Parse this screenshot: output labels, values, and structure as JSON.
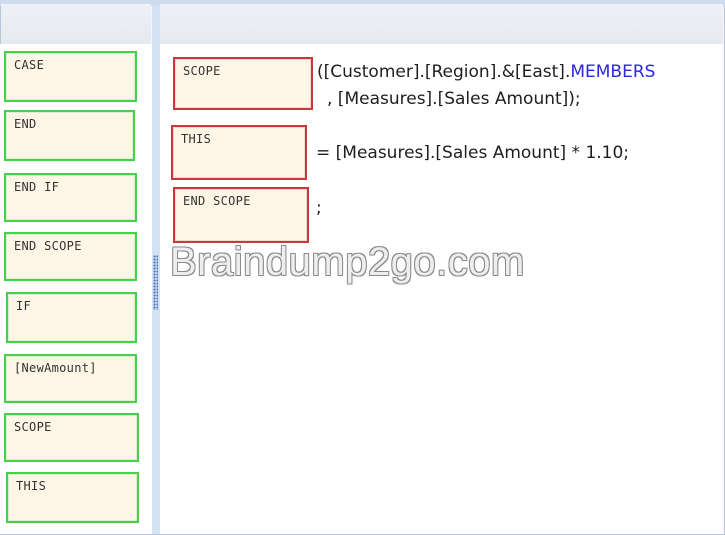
{
  "palette": {
    "options": [
      "CASE",
      "END",
      "END IF",
      "END SCOPE",
      "IF",
      "[NewAmount]",
      "SCOPE",
      "THIS"
    ]
  },
  "answer": {
    "slots": [
      "SCOPE",
      "THIS",
      "END SCOPE"
    ]
  },
  "code": {
    "line1_prefix": "([Customer].[Region].&[East].",
    "line1_keyword": "MEMBERS",
    "line2": ", [Measures].[Sales Amount]);",
    "line3": "= [Measures].[Sales Amount] * 1.10;",
    "line4": ";"
  },
  "watermark": "Braindump2go.com",
  "colors": {
    "option_border": "#48d04a",
    "answer_border": "#c8393d",
    "keyword": "#2a2ad4"
  }
}
